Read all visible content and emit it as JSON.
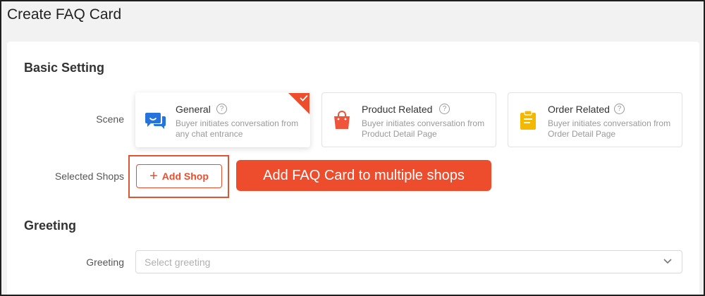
{
  "page": {
    "title": "Create FAQ Card"
  },
  "basic_setting": {
    "title": "Basic Setting",
    "scene_label": "Scene",
    "scenes": [
      {
        "title": "General",
        "description": "Buyer initiates conversation from any chat entrance",
        "icon": "chat-bubbles-icon",
        "selected": true
      },
      {
        "title": "Product Related",
        "description": "Buyer initiates conversation from Product Detail Page",
        "icon": "shopping-bag-icon",
        "selected": false
      },
      {
        "title": "Order Related",
        "description": "Buyer initiates conversation from Order Detail Page",
        "icon": "clipboard-icon",
        "selected": false
      }
    ],
    "selected_shops_label": "Selected Shops",
    "add_shop_label": "Add Shop",
    "callout_text": "Add FAQ Card to multiple shops"
  },
  "greeting": {
    "title": "Greeting",
    "greeting_label": "Greeting",
    "select_placeholder": "Select greeting"
  },
  "colors": {
    "accent": "#ee4d2d",
    "general_icon": "#2673dd",
    "product_icon": "#f0553c",
    "order_icon": "#f5b800"
  }
}
